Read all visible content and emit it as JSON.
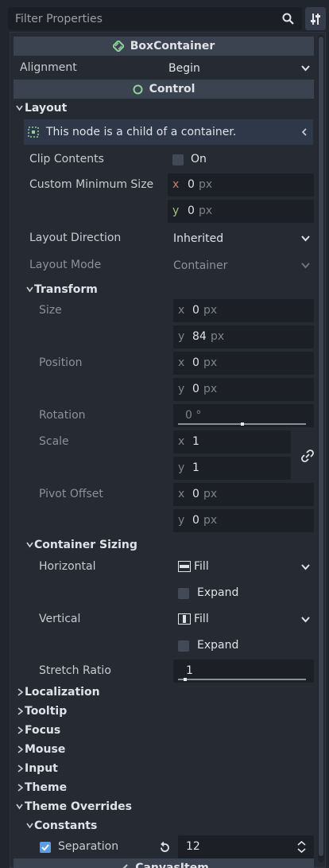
{
  "filter": {
    "placeholder": "Filter Properties"
  },
  "box_container": {
    "title": "BoxContainer",
    "alignment_label": "Alignment",
    "alignment_value": "Begin"
  },
  "control": {
    "title": "Control"
  },
  "layout": {
    "title": "Layout",
    "info": "This node is a child of a container.",
    "clip_contents_label": "Clip Contents",
    "clip_contents_value": "On",
    "custom_min_size_label": "Custom Minimum Size",
    "custom_min_x": "0",
    "custom_min_y": "0",
    "layout_direction_label": "Layout Direction",
    "layout_direction_value": "Inherited",
    "layout_mode_label": "Layout Mode",
    "layout_mode_value": "Container"
  },
  "axes": {
    "x": "x",
    "y": "y",
    "unit_px": "px"
  },
  "transform": {
    "title": "Transform",
    "size_label": "Size",
    "size_x": "0",
    "size_y": "84",
    "position_label": "Position",
    "position_x": "0",
    "position_y": "0",
    "rotation_label": "Rotation",
    "rotation_value": "0 °",
    "scale_label": "Scale",
    "scale_x": "1",
    "scale_y": "1",
    "pivot_label": "Pivot Offset",
    "pivot_x": "0",
    "pivot_y": "0"
  },
  "container_sizing": {
    "title": "Container Sizing",
    "horizontal_label": "Horizontal",
    "horizontal_value": "Fill",
    "horizontal_expand": "Expand",
    "vertical_label": "Vertical",
    "vertical_value": "Fill",
    "vertical_expand": "Expand",
    "stretch_label": "Stretch Ratio",
    "stretch_value": "1"
  },
  "sections": [
    "Localization",
    "Tooltip",
    "Focus",
    "Mouse",
    "Input",
    "Theme"
  ],
  "theme_overrides": {
    "title": "Theme Overrides",
    "constants_title": "Constants",
    "separation_label": "Separation",
    "separation_value": "12"
  },
  "canvas_item": {
    "title": "CanvasItem"
  },
  "colors": {
    "background": "#21262e",
    "header": "#3b4250",
    "field": "#1c1f26",
    "accent": "#5a9de3",
    "axis_x": "#c9826a",
    "axis_y": "#9fc27c"
  }
}
